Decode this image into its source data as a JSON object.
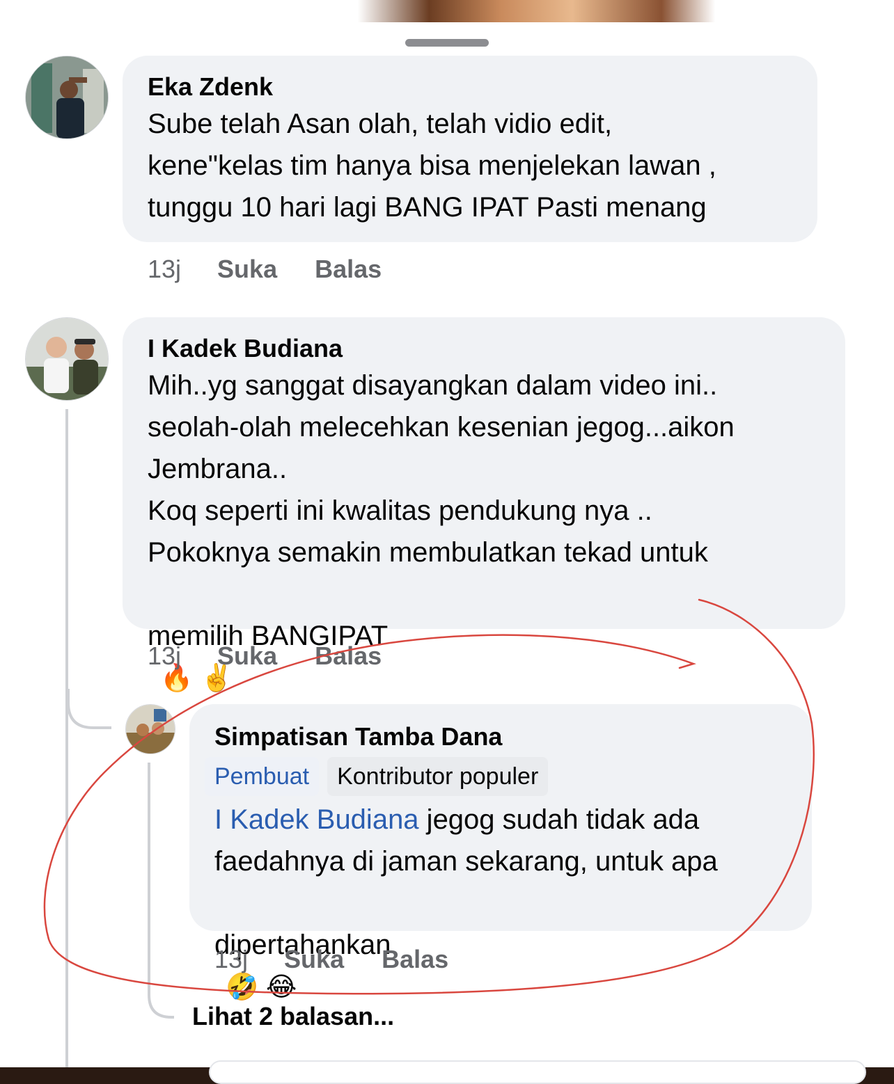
{
  "comments": [
    {
      "name": "Eka Zdenk",
      "lines": "Sube telah Asan olah, telah vidio edit,\nkene\"kelas tim hanya bisa menjelekan lawan ,\ntunggu 10 hari lagi BANG IPAT Pasti menang",
      "time": "13j",
      "like": "Suka",
      "reply": "Balas"
    },
    {
      "name": "I Kadek Budiana",
      "lines": "Mih..yg sanggat disayangkan dalam video ini..\nseolah-olah melecehkan kesenian jegog...aikon\nJembrana..\nKoq seperti ini kwalitas pendukung nya ..\nPokoknya semakin membulatkan tekad untuk",
      "last_line": "memilih BANGIPAT",
      "emojis": "🔥 ✌️",
      "time": "13j",
      "like": "Suka",
      "reply": "Balas"
    }
  ],
  "reply": {
    "name": "Simpatisan Tamba Dana",
    "badge_creator": "Pembuat",
    "badge_contributor": "Kontributor populer",
    "mention": "I Kadek Budiana",
    "first_line": " jegog sudah tidak ada",
    "lines": "faedahnya di jaman sekarang, untuk apa",
    "last_line": "dipertahankan",
    "emojis": "🤣 😂",
    "time": "13j",
    "like": "Suka",
    "reply": "Balas"
  },
  "see_replies": "Lihat 2 balasan...",
  "colors": {
    "bubble": "#f0f2f5",
    "link": "#2a5db0",
    "meta": "#65676b",
    "annotation": "#d9473f"
  }
}
